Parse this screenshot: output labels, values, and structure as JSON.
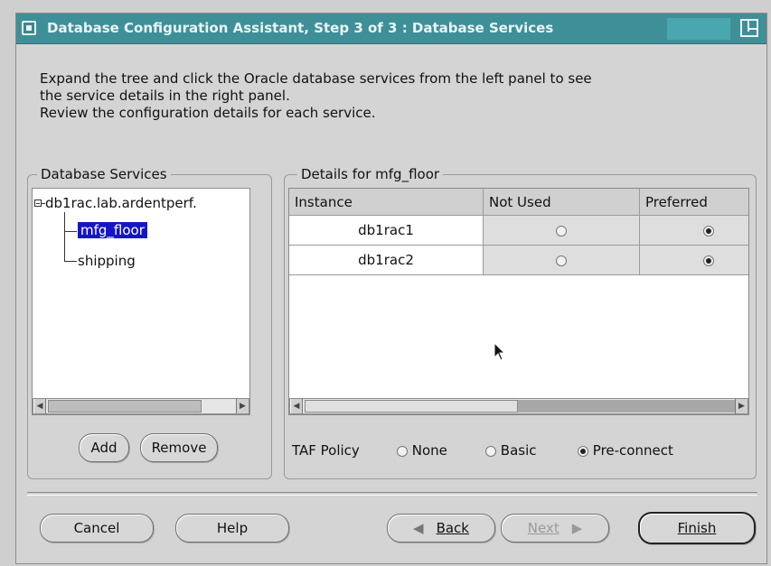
{
  "window": {
    "title": "Database Configuration Assistant, Step 3 of 3 : Database Services"
  },
  "instructions": {
    "line1": "Expand the tree and click the Oracle database services from the left panel to see",
    "line2": "the service details in the right panel.",
    "line3": "Review the configuration details for each service."
  },
  "services_panel": {
    "legend": "Database Services",
    "tree": {
      "root": "db1rac.lab.ardentperf.",
      "children": [
        {
          "label": "mfg_floor",
          "selected": true
        },
        {
          "label": "shipping",
          "selected": false
        }
      ]
    },
    "add_label": "Add",
    "remove_label": "Remove"
  },
  "details_panel": {
    "legend": "Details for mfg_floor",
    "columns": [
      "Instance",
      "Not Used",
      "Preferred"
    ],
    "rows": [
      {
        "instance": "db1rac1",
        "not_used": false,
        "preferred": true
      },
      {
        "instance": "db1rac2",
        "not_used": false,
        "preferred": true
      }
    ],
    "taf_label": "TAF Policy",
    "taf_options": [
      {
        "label": "None",
        "selected": false
      },
      {
        "label": "Basic",
        "selected": false
      },
      {
        "label": "Pre-connect",
        "selected": true
      }
    ]
  },
  "buttons": {
    "cancel": "Cancel",
    "help": "Help",
    "back": "Back",
    "next": "Next",
    "finish": "Finish"
  },
  "colors": {
    "titlebar": "#3f8f98",
    "selection": "#1515c8"
  }
}
